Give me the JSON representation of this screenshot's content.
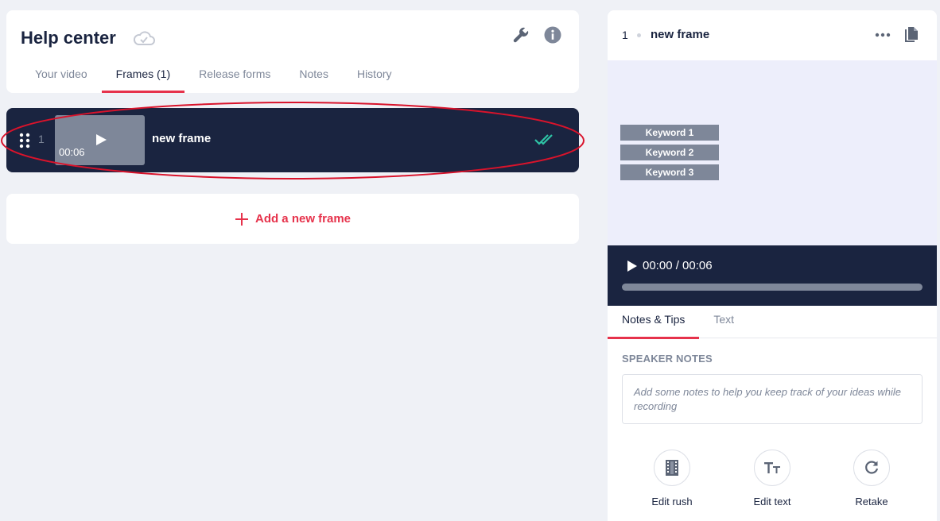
{
  "header": {
    "title": "Help center",
    "tabs": [
      {
        "label": "Your video",
        "active": false
      },
      {
        "label": "Frames (1)",
        "active": true
      },
      {
        "label": "Release forms",
        "active": false
      },
      {
        "label": "Notes",
        "active": false
      },
      {
        "label": "History",
        "active": false
      }
    ]
  },
  "frames": [
    {
      "number": "1",
      "duration": "00:06",
      "title": "new frame",
      "status_icon": "double-check-icon"
    }
  ],
  "add_frame": {
    "label": "Add a new frame"
  },
  "panel": {
    "frame_number": "1",
    "frame_title": "new frame",
    "keywords": [
      "Keyword 1",
      "Keyword 2",
      "Keyword 3"
    ],
    "player": {
      "time": "00:00 / 00:06",
      "progress_fraction": 0
    },
    "tabs": [
      {
        "label": "Notes & Tips",
        "active": true
      },
      {
        "label": "Text",
        "active": false
      }
    ],
    "speaker_notes": {
      "heading": "SPEAKER NOTES",
      "placeholder": "Add some notes to help you keep track of your ideas while recording",
      "value": ""
    },
    "actions": [
      {
        "label": "Edit rush",
        "icon": "film-icon"
      },
      {
        "label": "Edit text",
        "icon": "text-size-icon"
      },
      {
        "label": "Retake",
        "icon": "refresh-icon"
      }
    ]
  },
  "colors": {
    "accent": "#e6324b",
    "navy": "#1a2440",
    "muted": "#7e8799",
    "success": "#2ec4a6",
    "preview_bg": "#edeefb",
    "page_bg": "#eff1f6"
  }
}
